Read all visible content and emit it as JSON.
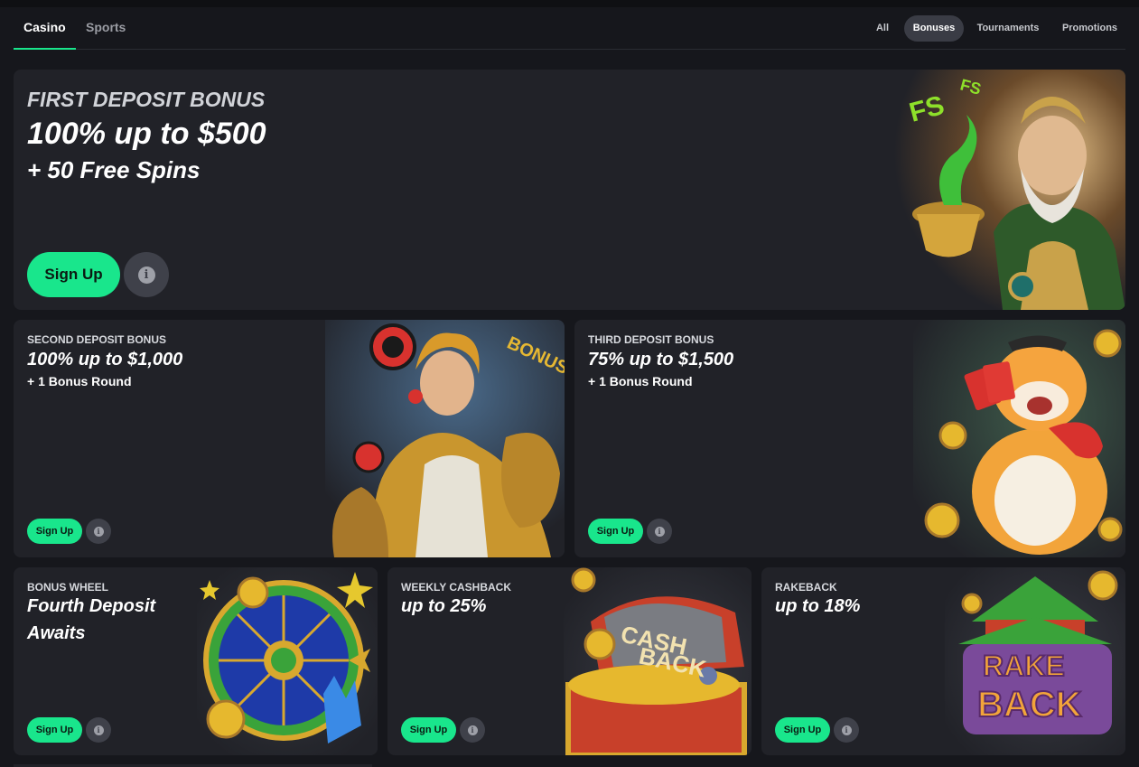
{
  "nav": {
    "tabs": [
      {
        "label": "Casino",
        "active": true
      },
      {
        "label": "Sports",
        "active": false
      }
    ],
    "filters": [
      {
        "label": "All",
        "active": false
      },
      {
        "label": "Bonuses",
        "active": true
      },
      {
        "label": "Tournaments",
        "active": false
      },
      {
        "label": "Promotions",
        "active": false
      }
    ]
  },
  "hero": {
    "label": "FIRST DEPOSIT BONUS",
    "title": "100% up to $500",
    "subtitle": "+ 50 Free Spins",
    "signup_label": "Sign Up",
    "art_text": "FS"
  },
  "cards": [
    {
      "label": "SECOND DEPOSIT BONUS",
      "title": "100% up to $1,000",
      "subtitle": "+ 1 Bonus Round",
      "signup_label": "Sign Up",
      "art_text": "BONUS"
    },
    {
      "label": "THIRD DEPOSIT BONUS",
      "title": "75% up to $1,500",
      "subtitle": "+ 1 Bonus Round",
      "signup_label": "Sign Up"
    },
    {
      "label": "BONUS WHEEL",
      "title": "Fourth Deposit",
      "title2": "Awaits",
      "signup_label": "Sign Up"
    },
    {
      "label": "WEEKLY CASHBACK",
      "title": "up to 25%",
      "signup_label": "Sign Up",
      "art_text": "CASH",
      "art_text2": "BACK"
    },
    {
      "label": "RAKEBACK",
      "title": "up to 18%",
      "signup_label": "Sign Up",
      "art_text": "RAKE",
      "art_text2": "BACK"
    }
  ],
  "colors": {
    "accent": "#19e68c",
    "card_bg": "#212228",
    "page_bg": "#16171c"
  },
  "icons": {
    "info": "info-icon"
  }
}
